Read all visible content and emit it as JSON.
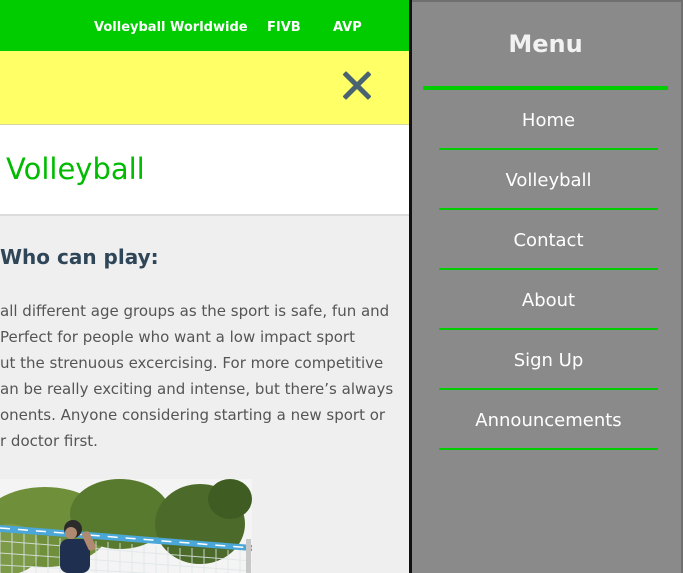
{
  "topnav": {
    "links": [
      "Volleyball Worldwide",
      "FIVB",
      "AVP"
    ]
  },
  "header": {
    "close_icon": "close-x-icon"
  },
  "page": {
    "title": "Volleyball",
    "section_heading": "Who can play:",
    "paragraph_lines": [
      "all different age groups as the sport is safe, fun and",
      "Perfect for people who want a low impact sport",
      "ut the strenuous excercising. For more competitive",
      "an be really exciting and intense, but there’s always",
      "onents. Anyone considering starting a new sport or",
      "r doctor first."
    ]
  },
  "menu": {
    "title": "Menu",
    "items": [
      "Home",
      "Volleyball",
      "Contact",
      "About",
      "Sign Up",
      "Announcements"
    ]
  },
  "colors": {
    "accent_green": "#00cc00",
    "banner_yellow": "#ffff66",
    "sidenav_gray": "#8a8a8a",
    "heading_dark": "#2e4657"
  }
}
